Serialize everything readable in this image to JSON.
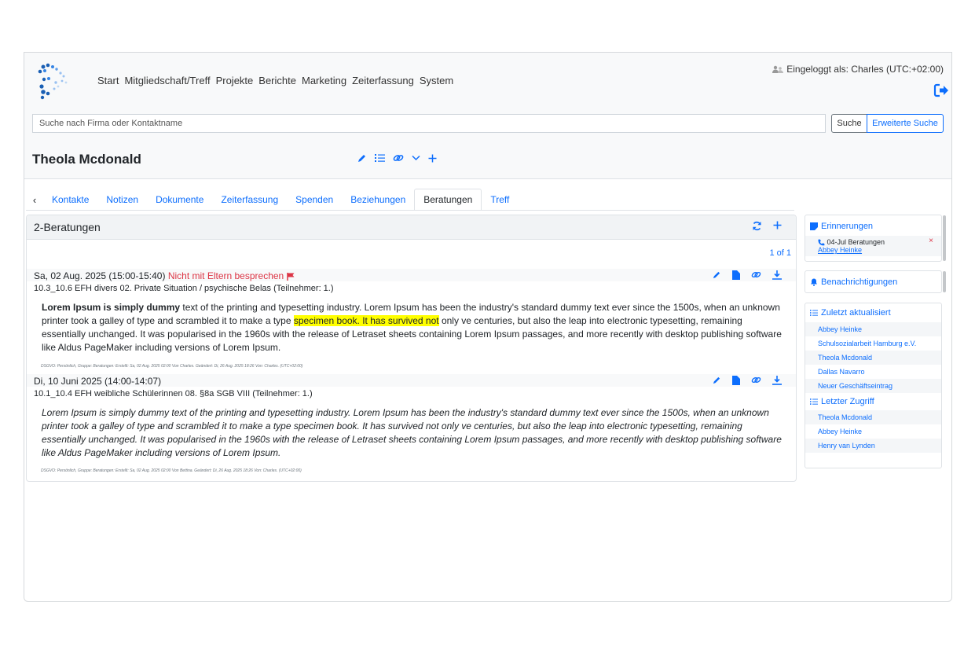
{
  "header": {
    "nav": [
      "Start",
      "Mitgliedschaft/Treff",
      "Projekte",
      "Berichte",
      "Marketing",
      "Zeiterfassung",
      "System"
    ],
    "logged_in": "Eingeloggt als: Charles (UTC:+02:00)"
  },
  "search": {
    "placeholder": "Suche nach Firma oder Kontaktname",
    "search_label": "Suche",
    "advanced_label": "Erweiterte Suche"
  },
  "contact": {
    "name": "Theola Mcdonald"
  },
  "tabs": [
    {
      "label": "Kontakte"
    },
    {
      "label": "Notizen"
    },
    {
      "label": "Dokumente"
    },
    {
      "label": "Zeiterfassung"
    },
    {
      "label": "Spenden"
    },
    {
      "label": "Beziehungen"
    },
    {
      "label": "Beratungen",
      "active": true
    },
    {
      "label": "Treff"
    }
  ],
  "panel": {
    "title": "2-Beratungen",
    "pager": "1 of 1"
  },
  "entries": [
    {
      "date": "Sa, 02 Aug. 2025 (15:00-15:40)",
      "flag_text": "Nicht mit Eltern besprechen",
      "subtitle": "10.3_10.6 EFH divers 02. Private Situation / psychische Belas (Teilnehmer: 1.)",
      "body_bold": "Lorem Ipsum is simply dummy",
      "body_pre": " text of the printing and typesetting industry. Lorem Ipsum has been the industry's standard dummy text ever since the 1500s, when an unknown printer took a galley of type and scrambled it to make a type ",
      "body_highlight": "specimen book. It has survived not",
      "body_post": " only ve centuries, but also the leap into electronic typesetting, remaining essentially unchanged. It was popularised in the 1960s with the release of Letraset sheets containing Lorem Ipsum passages, and more recently with desktop publishing software like Aldus PageMaker including versions of Lorem Ipsum.",
      "meta": "DSGVO: Persönlich, Gruppe: Beratungen: Erstellt: Sa, 02 Aug. 2025 02:00 Von Charles. Geändert: Di, 26 Aug. 2025 18:26 Von: Charles. (UTC+02:00)"
    },
    {
      "date": "Di, 10 Juni 2025 (14:00-14:07)",
      "subtitle": "10.1_10.4 EFH weibliche Schülerinnen 08. §8a SGB VIII (Teilnehmer: 1.)",
      "body": "Lorem Ipsum is simply dummy text of the printing and typesetting industry. Lorem Ipsum has been the industry's standard dummy text ever since the 1500s, when an unknown printer took a galley of type and scrambled it to make a type specimen book. It has survived not only ve centuries, but also the leap into electronic typesetting, remaining essentially unchanged. It was popularised in the 1960s with the release of Letraset sheets containing Lorem Ipsum passages, and more recently with desktop publishing software like Aldus PageMaker including versions of Lorem Ipsum.",
      "meta": "DSGVO: Persönlich, Gruppe: Beratungen: Erstellt: Sa, 02 Aug. 2025 02:00 Von Bettina. Geändert: Di, 26 Aug. 2025 18:26 Von: Charles. (UTC+02:00)"
    }
  ],
  "sidebar": {
    "reminders_title": "Erinnerungen",
    "reminder": {
      "text": "04-Jul Beratungen",
      "link": "Abbey Heinke",
      "close": "×"
    },
    "notifications_title": "Benachrichtigungen",
    "recent_title": "Zuletzt aktualisiert",
    "recent_items": [
      "Abbey Heinke",
      "Schulsozialarbeit Hamburg e.V.",
      "Theola Mcdonald",
      "Dallas Navarro",
      "Neuer Geschäftseintrag"
    ],
    "last_access_title": "Letzter Zugriff",
    "last_access_items": [
      "Theola Mcdonald",
      "Abbey Heinke",
      "Henry van Lynden"
    ]
  },
  "colors": {
    "accent": "#0d6efd",
    "danger": "#dc3545",
    "highlight": "#ffff00"
  }
}
